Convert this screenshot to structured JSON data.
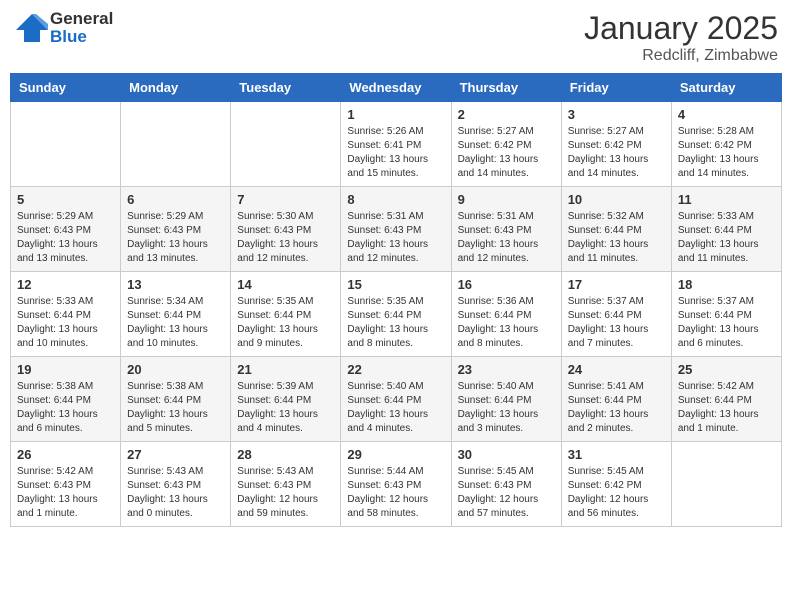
{
  "header": {
    "logo": {
      "general": "General",
      "blue": "Blue"
    },
    "month": "January 2025",
    "location": "Redcliff, Zimbabwe"
  },
  "days_of_week": [
    "Sunday",
    "Monday",
    "Tuesday",
    "Wednesday",
    "Thursday",
    "Friday",
    "Saturday"
  ],
  "weeks": [
    {
      "days": [
        {
          "num": "",
          "info": ""
        },
        {
          "num": "",
          "info": ""
        },
        {
          "num": "",
          "info": ""
        },
        {
          "num": "1",
          "info": "Sunrise: 5:26 AM\nSunset: 6:41 PM\nDaylight: 13 hours\nand 15 minutes."
        },
        {
          "num": "2",
          "info": "Sunrise: 5:27 AM\nSunset: 6:42 PM\nDaylight: 13 hours\nand 14 minutes."
        },
        {
          "num": "3",
          "info": "Sunrise: 5:27 AM\nSunset: 6:42 PM\nDaylight: 13 hours\nand 14 minutes."
        },
        {
          "num": "4",
          "info": "Sunrise: 5:28 AM\nSunset: 6:42 PM\nDaylight: 13 hours\nand 14 minutes."
        }
      ]
    },
    {
      "days": [
        {
          "num": "5",
          "info": "Sunrise: 5:29 AM\nSunset: 6:43 PM\nDaylight: 13 hours\nand 13 minutes."
        },
        {
          "num": "6",
          "info": "Sunrise: 5:29 AM\nSunset: 6:43 PM\nDaylight: 13 hours\nand 13 minutes."
        },
        {
          "num": "7",
          "info": "Sunrise: 5:30 AM\nSunset: 6:43 PM\nDaylight: 13 hours\nand 12 minutes."
        },
        {
          "num": "8",
          "info": "Sunrise: 5:31 AM\nSunset: 6:43 PM\nDaylight: 13 hours\nand 12 minutes."
        },
        {
          "num": "9",
          "info": "Sunrise: 5:31 AM\nSunset: 6:43 PM\nDaylight: 13 hours\nand 12 minutes."
        },
        {
          "num": "10",
          "info": "Sunrise: 5:32 AM\nSunset: 6:44 PM\nDaylight: 13 hours\nand 11 minutes."
        },
        {
          "num": "11",
          "info": "Sunrise: 5:33 AM\nSunset: 6:44 PM\nDaylight: 13 hours\nand 11 minutes."
        }
      ]
    },
    {
      "days": [
        {
          "num": "12",
          "info": "Sunrise: 5:33 AM\nSunset: 6:44 PM\nDaylight: 13 hours\nand 10 minutes."
        },
        {
          "num": "13",
          "info": "Sunrise: 5:34 AM\nSunset: 6:44 PM\nDaylight: 13 hours\nand 10 minutes."
        },
        {
          "num": "14",
          "info": "Sunrise: 5:35 AM\nSunset: 6:44 PM\nDaylight: 13 hours\nand 9 minutes."
        },
        {
          "num": "15",
          "info": "Sunrise: 5:35 AM\nSunset: 6:44 PM\nDaylight: 13 hours\nand 8 minutes."
        },
        {
          "num": "16",
          "info": "Sunrise: 5:36 AM\nSunset: 6:44 PM\nDaylight: 13 hours\nand 8 minutes."
        },
        {
          "num": "17",
          "info": "Sunrise: 5:37 AM\nSunset: 6:44 PM\nDaylight: 13 hours\nand 7 minutes."
        },
        {
          "num": "18",
          "info": "Sunrise: 5:37 AM\nSunset: 6:44 PM\nDaylight: 13 hours\nand 6 minutes."
        }
      ]
    },
    {
      "days": [
        {
          "num": "19",
          "info": "Sunrise: 5:38 AM\nSunset: 6:44 PM\nDaylight: 13 hours\nand 6 minutes."
        },
        {
          "num": "20",
          "info": "Sunrise: 5:38 AM\nSunset: 6:44 PM\nDaylight: 13 hours\nand 5 minutes."
        },
        {
          "num": "21",
          "info": "Sunrise: 5:39 AM\nSunset: 6:44 PM\nDaylight: 13 hours\nand 4 minutes."
        },
        {
          "num": "22",
          "info": "Sunrise: 5:40 AM\nSunset: 6:44 PM\nDaylight: 13 hours\nand 4 minutes."
        },
        {
          "num": "23",
          "info": "Sunrise: 5:40 AM\nSunset: 6:44 PM\nDaylight: 13 hours\nand 3 minutes."
        },
        {
          "num": "24",
          "info": "Sunrise: 5:41 AM\nSunset: 6:44 PM\nDaylight: 13 hours\nand 2 minutes."
        },
        {
          "num": "25",
          "info": "Sunrise: 5:42 AM\nSunset: 6:44 PM\nDaylight: 13 hours\nand 1 minute."
        }
      ]
    },
    {
      "days": [
        {
          "num": "26",
          "info": "Sunrise: 5:42 AM\nSunset: 6:43 PM\nDaylight: 13 hours\nand 1 minute."
        },
        {
          "num": "27",
          "info": "Sunrise: 5:43 AM\nSunset: 6:43 PM\nDaylight: 13 hours\nand 0 minutes."
        },
        {
          "num": "28",
          "info": "Sunrise: 5:43 AM\nSunset: 6:43 PM\nDaylight: 12 hours\nand 59 minutes."
        },
        {
          "num": "29",
          "info": "Sunrise: 5:44 AM\nSunset: 6:43 PM\nDaylight: 12 hours\nand 58 minutes."
        },
        {
          "num": "30",
          "info": "Sunrise: 5:45 AM\nSunset: 6:43 PM\nDaylight: 12 hours\nand 57 minutes."
        },
        {
          "num": "31",
          "info": "Sunrise: 5:45 AM\nSunset: 6:42 PM\nDaylight: 12 hours\nand 56 minutes."
        },
        {
          "num": "",
          "info": ""
        }
      ]
    }
  ]
}
